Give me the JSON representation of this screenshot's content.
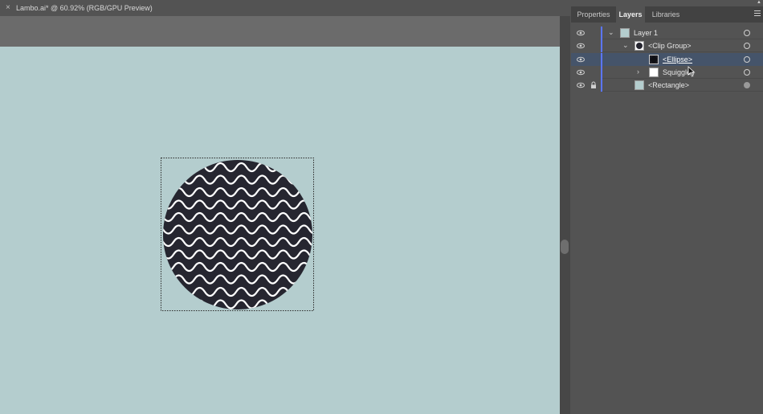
{
  "document": {
    "close_glyph": "×",
    "title": "Lambo.ai* @ 60.92% (RGB/GPU Preview)"
  },
  "panel": {
    "tabs": [
      {
        "label": "Properties",
        "active": false
      },
      {
        "label": "Layers",
        "active": true
      },
      {
        "label": "Libraries",
        "active": false
      }
    ]
  },
  "layers": [
    {
      "name": "Layer 1",
      "expanded": true,
      "selected": false,
      "locked": false,
      "visible": true
    },
    {
      "name": "<Clip Group>",
      "expanded": true,
      "selected": false,
      "locked": false,
      "visible": true
    },
    {
      "name": "<Ellipse>",
      "selected": true,
      "locked": false,
      "visible": true
    },
    {
      "name": "Squiggles",
      "expanded": false,
      "selected": false,
      "locked": false,
      "visible": true
    },
    {
      "name": "<Rectangle>",
      "selected": false,
      "locked": true,
      "visible": true
    }
  ],
  "colors": {
    "artboard": "#b4cdce",
    "ellipse_fill": "#262630",
    "squiggle_stroke": "#ffffff",
    "layer_color": "#5b76ff",
    "selection_row": "#45546a"
  },
  "icons": {
    "close": "close-icon",
    "eye": "eye-icon",
    "lock": "lock-icon",
    "chevron_down": "chevron-down-icon",
    "chevron_right": "chevron-right-icon",
    "panel_menu": "menu-icon",
    "target": "target-icon"
  }
}
